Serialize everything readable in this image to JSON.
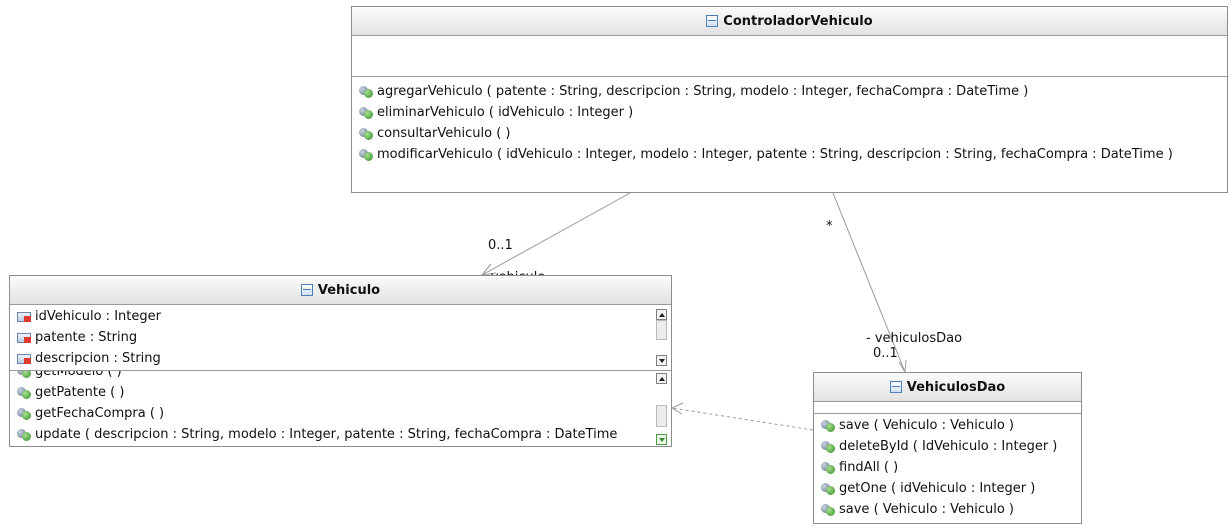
{
  "classes": {
    "controlador": {
      "name": "ControladorVehiculo",
      "operations": [
        "agregarVehiculo ( patente : String, descripcion : String, modelo : Integer, fechaCompra : DateTime )",
        "eliminarVehiculo ( idVehiculo : Integer )",
        "consultarVehiculo ( )",
        "modificarVehiculo ( idVehiculo : Integer, modelo : Integer, patente : String, descripcion : String, fechaCompra : DateTime )"
      ]
    },
    "vehiculo": {
      "name": "Vehiculo",
      "attributes": [
        "idVehiculo : Integer",
        "patente : String",
        "descripcion : String"
      ],
      "operations": [
        "getModelo ( )",
        "getPatente ( )",
        "getFechaCompra ( )",
        "update ( descripcion : String, modelo : Integer, patente : String, fechaCompra : DateTime"
      ]
    },
    "dao": {
      "name": "VehiculosDao",
      "operations": [
        "save ( Vehiculo : Vehiculo )",
        "deleteById ( IdVehiculo : Integer )",
        "findAll ( )",
        "getOne ( idVehiculo : Integer )",
        "save ( Vehiculo : Vehiculo )"
      ]
    }
  },
  "associations": {
    "ctrl_vehiculo": {
      "source_mult": "*",
      "target_mult": "0..1",
      "role": "- vehiculo"
    },
    "ctrl_dao": {
      "source_mult": "*",
      "target_mult": "0..1",
      "role": "- vehiculosDao"
    }
  },
  "icons": {
    "class": "class-icon",
    "operation": "operation-icon",
    "attribute": "attribute-icon"
  }
}
